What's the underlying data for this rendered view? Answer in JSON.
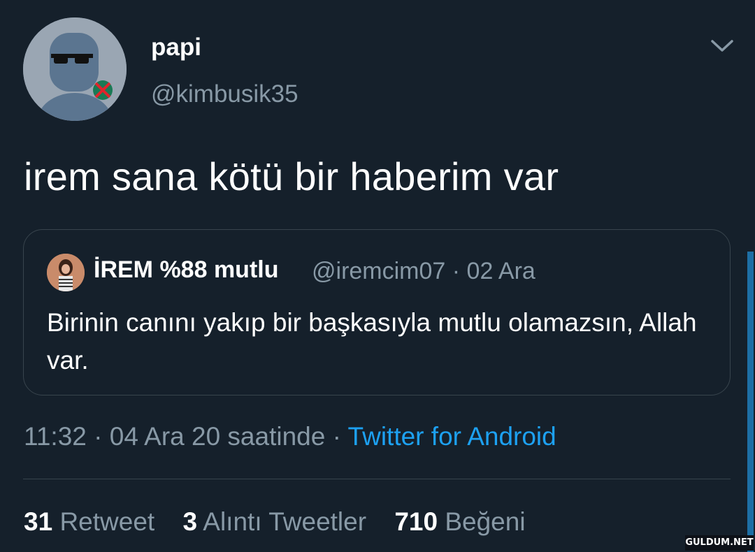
{
  "author": {
    "display_name": "papi",
    "handle": "@kimbusik35",
    "avatar_icon": "default-avatar-with-sunglasses"
  },
  "menu": {
    "icon": "chevron-down-icon"
  },
  "tweet": {
    "text": "irem sana kötü bir haberim var"
  },
  "quoted_tweet": {
    "display_name": "İREM %88 mutlu",
    "handle": "@iremcim07",
    "separator": " · ",
    "date": "02 Ara",
    "text": "Birinin canını yakıp bir başkasıyla mutlu olamazsın, Allah var."
  },
  "meta": {
    "time": "11:32",
    "separator": " · ",
    "date_text": "04 Ara 20 saatinde",
    "source": "Twitter for Android"
  },
  "stats": {
    "retweet_count": "31",
    "retweet_label": "Retweet",
    "quote_count": "3",
    "quote_label": "Alıntı Tweetler",
    "like_count": "710",
    "like_label": "Beğeni"
  },
  "watermark": "GULDUM.NET",
  "colors": {
    "background": "#15202b",
    "secondary_text": "#8899a6",
    "link": "#1da1f2",
    "border": "#38444d"
  }
}
